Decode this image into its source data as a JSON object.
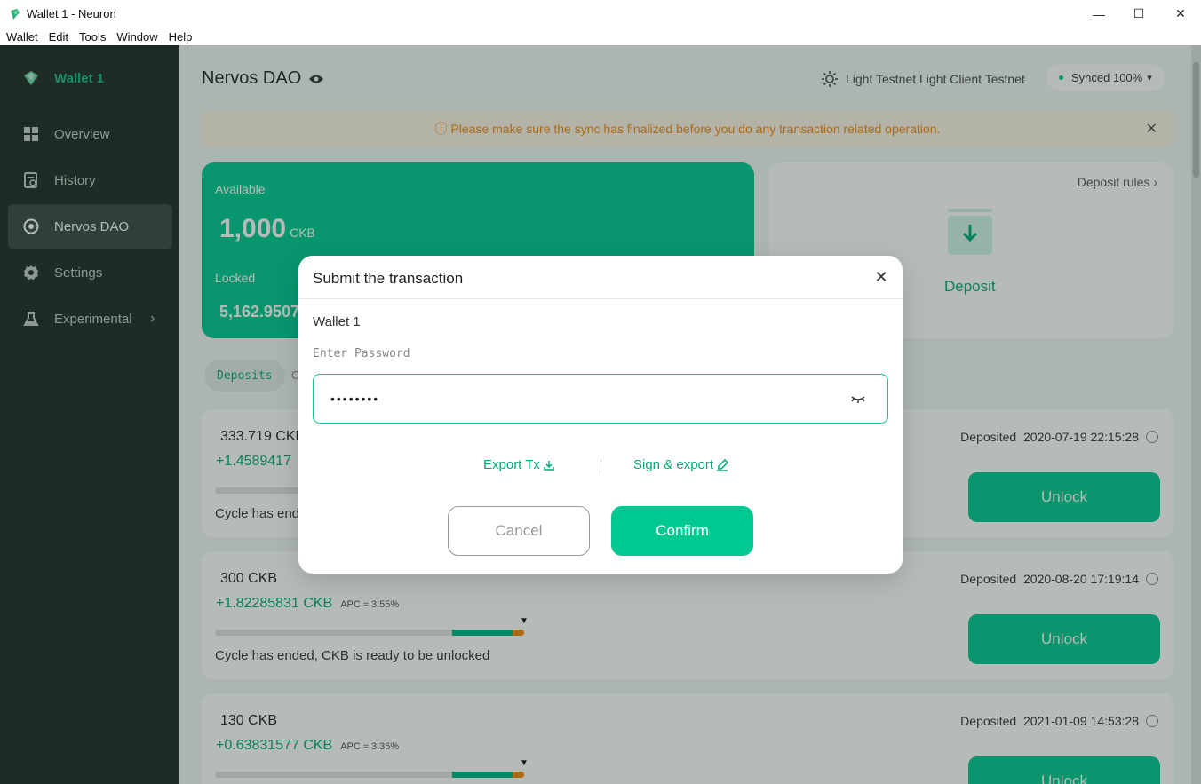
{
  "window": {
    "title": "Wallet 1 - Neuron",
    "minimize": "—",
    "maximize": "☐",
    "close": "✕"
  },
  "menu": [
    "Wallet",
    "Edit",
    "Tools",
    "Window",
    "Help"
  ],
  "sidebar": {
    "wallet_name": "Wallet 1",
    "items": [
      {
        "label": "Overview",
        "icon": "grid-icon"
      },
      {
        "label": "History",
        "icon": "history-icon"
      },
      {
        "label": "Nervos DAO",
        "icon": "dao-icon",
        "active": true
      },
      {
        "label": "Settings",
        "icon": "gear-icon"
      },
      {
        "label": "Experimental",
        "icon": "flask-icon",
        "chevron": "›"
      }
    ]
  },
  "header": {
    "title": "Nervos DAO",
    "network": "Light Testnet Light Client Testnet",
    "sync": "Synced 100%",
    "sync_caret": "▾"
  },
  "alert": {
    "text": "ⓘ Please make sure the sync has finalized before you do any transaction related operation.",
    "close": "✕"
  },
  "balance": {
    "available_label": "Available",
    "available_value": "1,000",
    "unit": "CKB",
    "locked_label": "Locked",
    "locked_value": "5,162.95071"
  },
  "deposit_card": {
    "rules": "Deposit rules",
    "rules_chevron": "›",
    "label": "Deposit"
  },
  "tabs": {
    "active": "Deposits",
    "other": "C"
  },
  "records": [
    {
      "amount": "333.719 CKB",
      "reward": "+1.4589417",
      "apc": "",
      "deposited_label": "Deposited",
      "deposited_time": "2020-07-19 22:15:28",
      "status": "Cycle has ended, CKB is ready to be unlocked",
      "unlock": "Unlock"
    },
    {
      "amount": "300 CKB",
      "reward": "+1.82285831 CKB",
      "apc": "APC ≈ 3.55%",
      "deposited_label": "Deposited",
      "deposited_time": "2020-08-20 17:19:14",
      "status": "Cycle has ended, CKB is ready to be unlocked",
      "unlock": "Unlock"
    },
    {
      "amount": "130 CKB",
      "reward": "+0.63831577 CKB",
      "apc": "APC ≈ 3.36%",
      "deposited_label": "Deposited",
      "deposited_time": "2021-01-09 14:53:28",
      "status": "",
      "unlock": "Unlock"
    }
  ],
  "dialog": {
    "title": "Submit the transaction",
    "wallet": "Wallet 1",
    "password_label": "Enter Password",
    "password_value": "••••••••",
    "export_tx": "Export Tx",
    "sign_export": "Sign & export",
    "cancel": "Cancel",
    "confirm": "Confirm",
    "close": "✕"
  },
  "colors": {
    "accent": "#00c891",
    "sidebar": "#1f2a24",
    "warning": "#f7860a"
  }
}
